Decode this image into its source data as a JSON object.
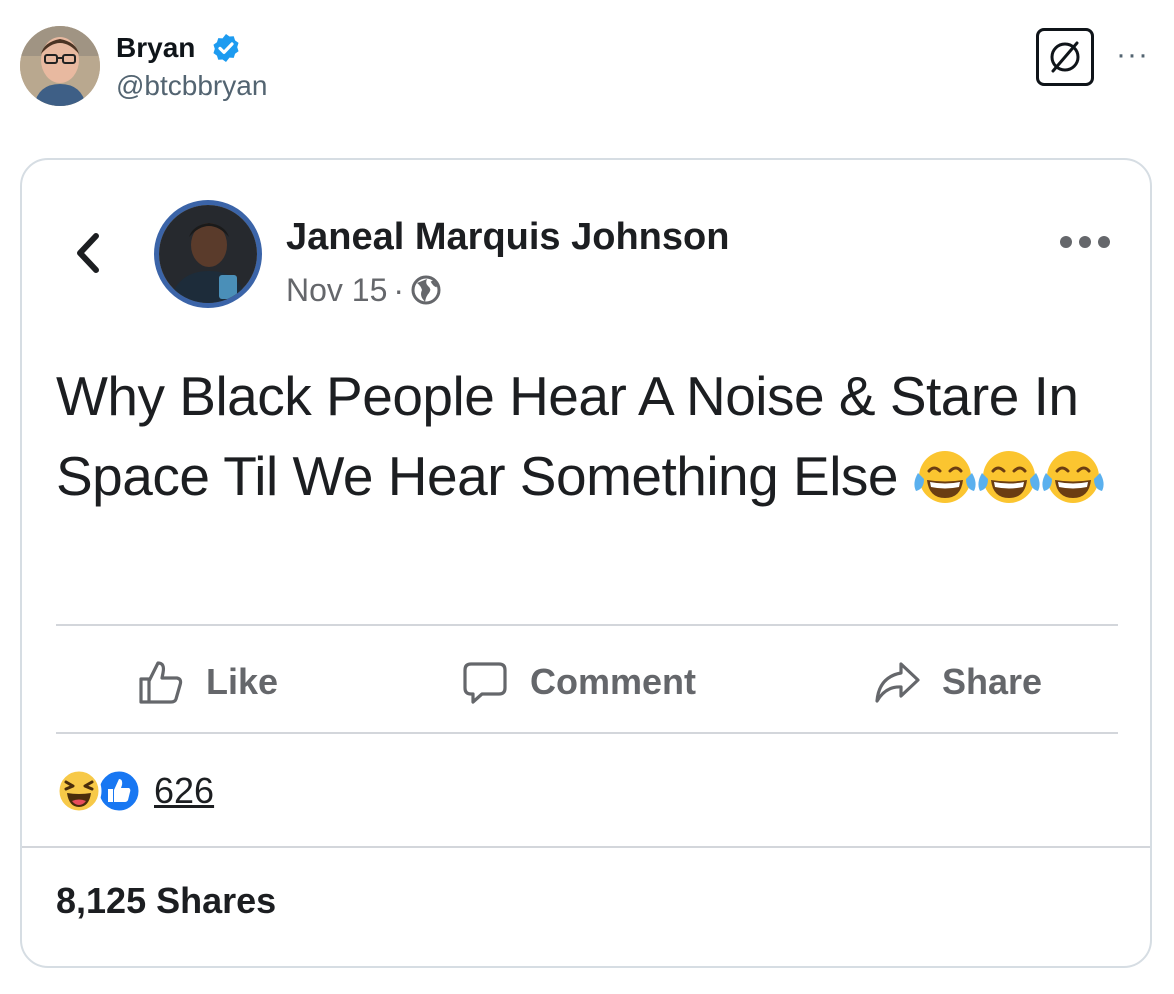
{
  "tweet": {
    "author_name": "Bryan",
    "author_handle": "@btcbbryan",
    "more_label": "···"
  },
  "fb_post": {
    "author": "Janeal Marquis Johnson",
    "date": "Nov 15",
    "separator": "·",
    "text": "Why Black People Hear A Noise & Stare In Space Til We Hear Something Else",
    "emoji": [
      "face-with-tears-of-joy-icon",
      "face-with-tears-of-joy-icon",
      "face-with-tears-of-joy-icon"
    ],
    "actions": {
      "like": "Like",
      "comment": "Comment",
      "share": "Share"
    },
    "reaction_count": "626",
    "shares_text": "8,125 Shares"
  },
  "colors": {
    "verified": "#1d9bf0",
    "fb_blue": "#1877f2",
    "fb_text": "#1c1e21",
    "fb_muted": "#65676b",
    "handle": "#536471"
  }
}
